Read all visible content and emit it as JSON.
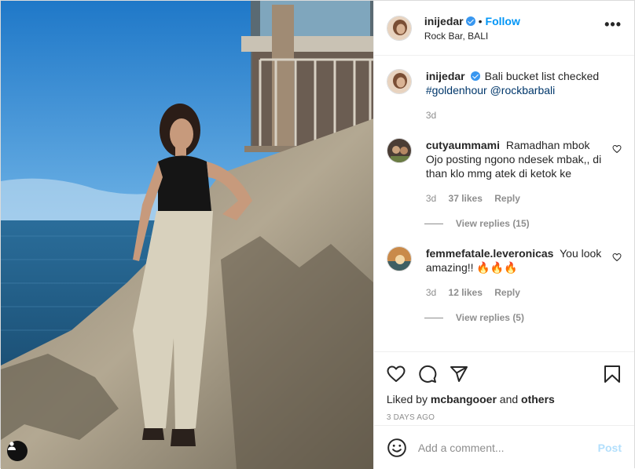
{
  "post": {
    "username": "inijedar",
    "follow_label": "Follow",
    "location": "Rock Bar, BALI",
    "more_label": "•••"
  },
  "caption": {
    "username": "inijedar",
    "text": "Bali bucket list checked",
    "hashtag": "#goldenhour",
    "mention": "@rockbarbali",
    "time": "3d"
  },
  "comments": [
    {
      "username": "cutyaummami",
      "text": "Ramadhan mbok Ojo posting ngono ndesek mbak,, di than klo mmg atek di ketok ke",
      "time": "3d",
      "likes": "37 likes",
      "reply_label": "Reply",
      "view_replies": "View replies (15)"
    },
    {
      "username": "femmefatale.leveronicas",
      "text": "You look amazing!! 🔥🔥🔥",
      "time": "3d",
      "likes": "12 likes",
      "reply_label": "Reply",
      "view_replies": "View replies (5)"
    }
  ],
  "engagement": {
    "liked_by_prefix": "Liked by",
    "liked_by_user": "mcbangooer",
    "liked_by_and": "and",
    "liked_by_others": "others",
    "time_ago": "3 DAYS AGO"
  },
  "add_comment": {
    "placeholder": "Add a comment...",
    "post_label": "Post"
  },
  "icons": {
    "like": "heart-icon",
    "comment": "comment-icon",
    "share": "share-icon",
    "save": "bookmark-icon",
    "emoji": "smile-icon",
    "tag": "user-tag-icon"
  },
  "colors": {
    "link": "#0095f6",
    "hashtag": "#00376b",
    "muted": "#8e8e8e",
    "post_disabled": "#b2dffc"
  }
}
